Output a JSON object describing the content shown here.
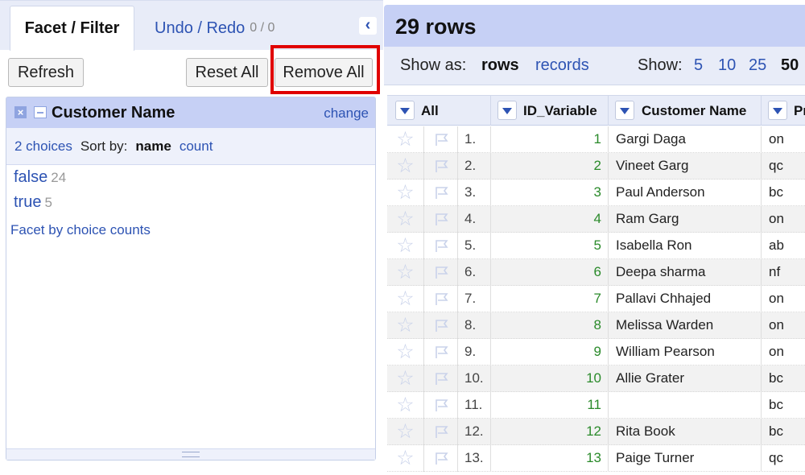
{
  "left_panel": {
    "tabs": {
      "facet_filter": "Facet / Filter",
      "undo_redo": "Undo / Redo",
      "undo_count": "0 / 0"
    },
    "collapse_icon": "chevron-left-icon",
    "buttons": {
      "refresh": "Refresh",
      "reset_all": "Reset All",
      "remove_all": "Remove All"
    },
    "facet": {
      "title": "Customer Name",
      "change": "change",
      "choices_count": "2 choices",
      "sort_by": "Sort by:",
      "sort_name": "name",
      "sort_count": "count",
      "choices": [
        {
          "label": "false",
          "count": "24"
        },
        {
          "label": "true",
          "count": "5"
        }
      ],
      "facet_by_counts": "Facet by choice counts"
    }
  },
  "right_panel": {
    "rows_title": "29 rows",
    "show_as_label": "Show as:",
    "show_as_rows": "rows",
    "show_as_records": "records",
    "show_label": "Show:",
    "page_sizes": [
      "5",
      "10",
      "25",
      "50"
    ],
    "selected_page_size": "50",
    "columns": {
      "all": "All",
      "id_variable": "ID_Variable",
      "customer_name": "Customer Name",
      "partial": "Pr"
    },
    "rows": [
      {
        "idx": "1.",
        "id": "1",
        "name": "Gargi Daga",
        "pr": "on"
      },
      {
        "idx": "2.",
        "id": "2",
        "name": "Vineet Garg",
        "pr": "qc"
      },
      {
        "idx": "3.",
        "id": "3",
        "name": "Paul Anderson",
        "pr": "bc"
      },
      {
        "idx": "4.",
        "id": "4",
        "name": "Ram Garg",
        "pr": "on"
      },
      {
        "idx": "5.",
        "id": "5",
        "name": "Isabella Ron",
        "pr": "ab"
      },
      {
        "idx": "6.",
        "id": "6",
        "name": "Deepa sharma",
        "pr": "nf"
      },
      {
        "idx": "7.",
        "id": "7",
        "name": "Pallavi Chhajed",
        "pr": "on"
      },
      {
        "idx": "8.",
        "id": "8",
        "name": "Melissa Warden",
        "pr": "on"
      },
      {
        "idx": "9.",
        "id": "9",
        "name": "William Pearson",
        "pr": "on"
      },
      {
        "idx": "10.",
        "id": "10",
        "name": "Allie Grater",
        "pr": "bc"
      },
      {
        "idx": "11.",
        "id": "11",
        "name": "",
        "pr": "bc"
      },
      {
        "idx": "12.",
        "id": "12",
        "name": "Rita Book",
        "pr": "bc"
      },
      {
        "idx": "13.",
        "id": "13",
        "name": "Paige Turner",
        "pr": "qc"
      }
    ]
  },
  "colors": {
    "header_blue": "#c6d0f5",
    "link_blue": "#2d53b3",
    "id_green": "#2a8a2a",
    "highlight_red": "#e00000"
  }
}
